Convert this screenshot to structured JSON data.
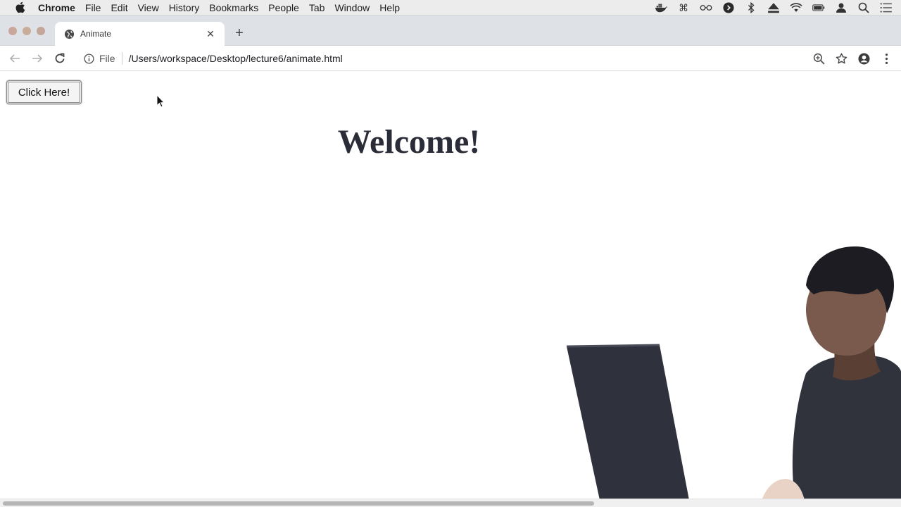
{
  "menubar": {
    "app_name": "Chrome",
    "items": [
      "File",
      "Edit",
      "View",
      "History",
      "Bookmarks",
      "People",
      "Tab",
      "Window",
      "Help"
    ]
  },
  "tab": {
    "title": "Animate",
    "close_glyph": "✕"
  },
  "new_tab_glyph": "+",
  "address_bar": {
    "scheme_label": "File",
    "url": "/Users/workspace/Desktop/lecture6/animate.html"
  },
  "page": {
    "button_label": "Click Here!",
    "heading": "Welcome!"
  },
  "colors": {
    "heading": "#2a2c38",
    "presenter_shirt": "#30323c",
    "laptop": "#2f313c"
  },
  "icons": {
    "menubar": [
      "apple-icon"
    ],
    "status": [
      "docker-icon",
      "command-icon",
      "glasses-icon",
      "play-circle-icon",
      "bluetooth-icon",
      "eject-icon",
      "wifi-icon",
      "battery-icon",
      "user-icon",
      "search-icon",
      "notification-center-icon"
    ],
    "toolbar": [
      "back-arrow-icon",
      "forward-arrow-icon",
      "reload-icon",
      "info-icon",
      "zoom-icon",
      "bookmark-star-icon",
      "profile-icon",
      "kebab-menu-icon"
    ]
  }
}
